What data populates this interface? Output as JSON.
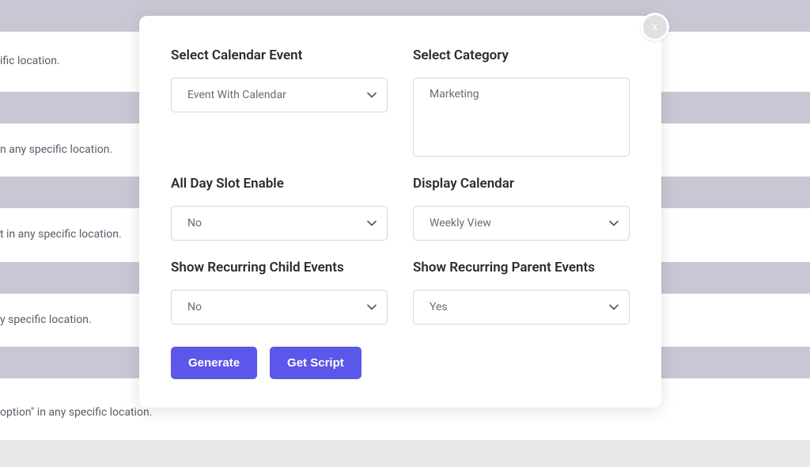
{
  "background": {
    "rows": [
      "ific location.",
      "n any specific location.",
      "t in any specific location.",
      "y specific location.",
      "option\" in any specific location."
    ]
  },
  "modal": {
    "close_label": "x",
    "fields": {
      "calendar_event": {
        "label": "Select Calendar Event",
        "value": "Event With Calendar"
      },
      "category": {
        "label": "Select Category",
        "value": "Marketing"
      },
      "all_day_slot": {
        "label": "All Day Slot Enable",
        "value": "No"
      },
      "display_calendar": {
        "label": "Display Calendar",
        "value": "Weekly View"
      },
      "recurring_child": {
        "label": "Show Recurring Child Events",
        "value": "No"
      },
      "recurring_parent": {
        "label": "Show Recurring Parent Events",
        "value": "Yes"
      }
    },
    "buttons": {
      "generate": "Generate",
      "get_script": "Get Script"
    }
  }
}
